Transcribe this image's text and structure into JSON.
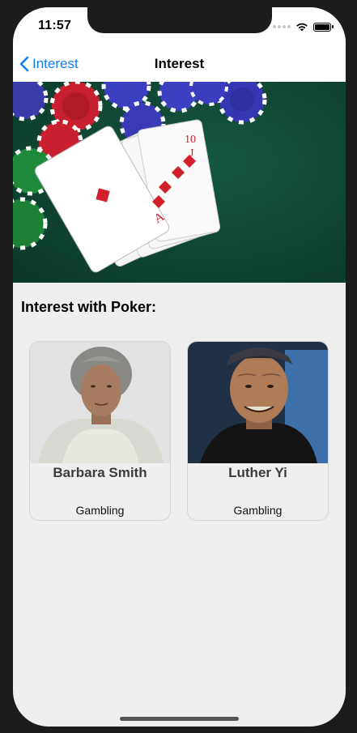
{
  "status_bar": {
    "time": "11:57"
  },
  "nav": {
    "back_label": "Interest",
    "title": "Interest"
  },
  "section": {
    "title": "Interest with Poker:"
  },
  "cards": [
    {
      "name": "Barbara Smith",
      "interest": "Gambling"
    },
    {
      "name": "Luther Yi",
      "interest": "Gambling"
    }
  ],
  "colors": {
    "accent": "#147efb",
    "background": "#efefef",
    "felt": "#0f4a36"
  }
}
